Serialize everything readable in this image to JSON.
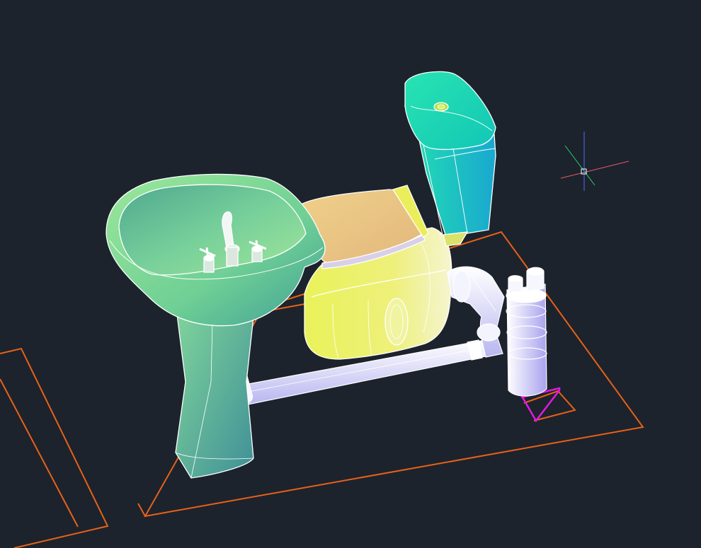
{
  "viewport": {
    "background": "#1c232c",
    "mode": "3D model space",
    "visual_style": "shaded with edges"
  },
  "colors": {
    "outline": "#e8611a",
    "marker": "#e01adf",
    "cursor_x": "#e05a6a",
    "cursor_y": "#2ecc71",
    "cursor_z": "#4f6bff",
    "cursor_box": "#ffffff",
    "sink": "#7fd48f",
    "pedestal": "#5fb090",
    "toilet_bowl": "#e8ef6a",
    "toilet_seat": "#eec98a",
    "tank": "#1fd6b3",
    "pipes": "#f3f3ff"
  },
  "objects": [
    {
      "name": "pedestal-sink",
      "icon": "sink-icon"
    },
    {
      "name": "toilet",
      "icon": "toilet-icon"
    },
    {
      "name": "toilet-tank",
      "icon": "tank-icon"
    },
    {
      "name": "drain-pipe",
      "icon": "pipe-icon"
    },
    {
      "name": "p-trap",
      "icon": "trap-icon"
    }
  ],
  "cursor": {
    "type": "crosshair",
    "axes": [
      "x",
      "y",
      "z"
    ]
  }
}
